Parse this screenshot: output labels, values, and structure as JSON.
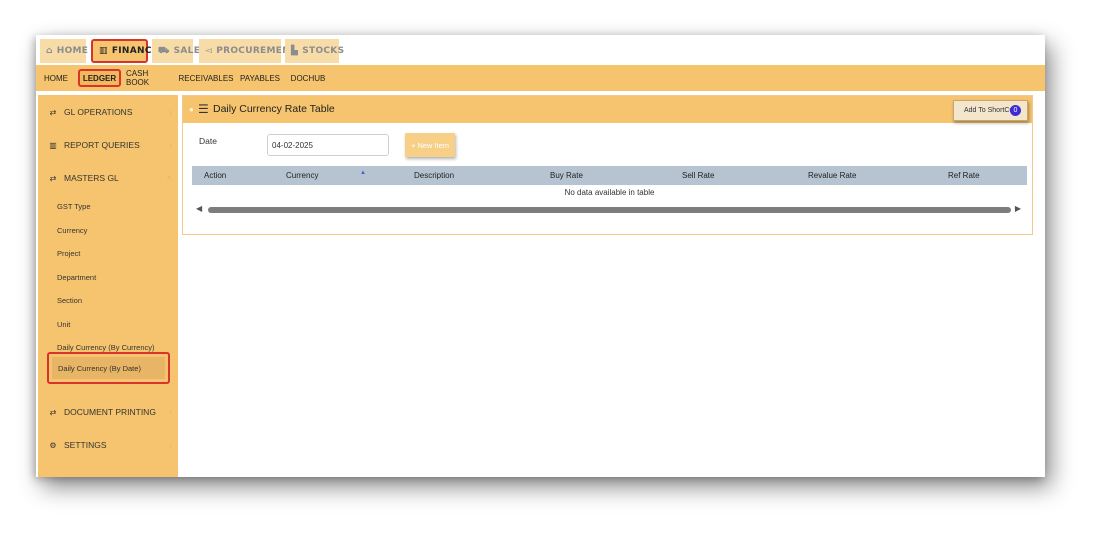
{
  "modules": [
    {
      "label": "HOME",
      "icon": "home-icon",
      "glyph": "⌂"
    },
    {
      "label": "FINANCE",
      "icon": "bank-icon",
      "glyph": "🏛"
    },
    {
      "label": "SALES",
      "icon": "cart-icon",
      "glyph": "⛟"
    },
    {
      "label": "PROCUREMENT",
      "icon": "megaphone-icon",
      "glyph": "📢"
    },
    {
      "label": "STOCKS",
      "icon": "chart-icon",
      "glyph": "▙"
    }
  ],
  "submenu": [
    "HOME",
    "LEDGER",
    "CASH BOOK",
    "RECEIVABLES",
    "PAYABLES",
    "DOCHUB"
  ],
  "sidebar": {
    "groups": [
      {
        "label": "GL OPERATIONS",
        "icon": "exchange-icon",
        "glyph": "⇄",
        "chevron": "›"
      },
      {
        "label": "REPORT QUERIES",
        "icon": "bar-chart-icon",
        "glyph": "▥",
        "chevron": "›"
      },
      {
        "label": "MASTERS GL",
        "icon": "exchange-icon",
        "glyph": "⇄",
        "chevron": "˄"
      },
      {
        "label": "DOCUMENT PRINTING",
        "icon": "exchange-icon",
        "glyph": "⇄",
        "chevron": "›"
      },
      {
        "label": "SETTINGS",
        "icon": "gears-icon",
        "glyph": "⚙",
        "chevron": "›"
      }
    ],
    "links": [
      "GST Type",
      "Currency",
      "Project",
      "Department",
      "Section",
      "Unit",
      "Daily Currency (By Currency)",
      "Daily Currency (By Date)"
    ]
  },
  "panel": {
    "title": "Daily Currency Rate Table",
    "shortcut_label": "Add To ShortCut",
    "shortcut_badge": "0",
    "date_label": "Date",
    "date_value": "04-02-2025",
    "new_item_label": "New Item",
    "new_item_glyph": "+",
    "columns": [
      "Action",
      "Currency",
      "Description",
      "Buy Rate",
      "Sell Rate",
      "Revalue Rate",
      "Ref Rate"
    ],
    "sort_glyph": "▲",
    "empty_text": "No data available in table"
  },
  "colors": {
    "accent": "#f6c46e",
    "highlight": "#d9342b",
    "table_header": "#b6c3d1"
  }
}
